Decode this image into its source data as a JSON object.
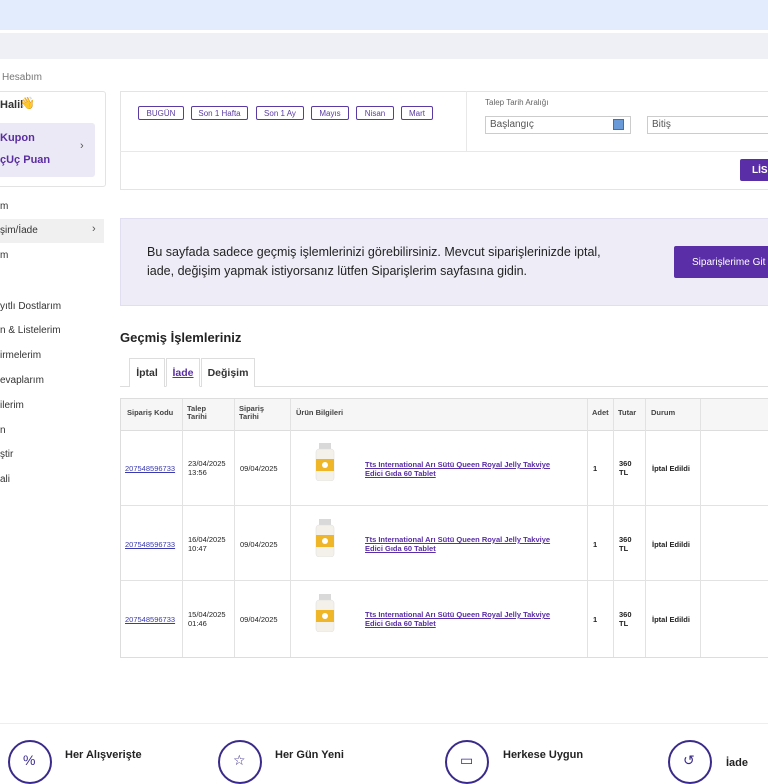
{
  "breadcrumb": "Hesabım",
  "sidebar": {
    "greeting": "Halil",
    "wave_icon": "waving-hand-icon",
    "coupon_line1": "Kupon",
    "coupon_line2": "çUç Puan",
    "items": [
      "m",
      "şim/İade",
      "m",
      "yıtlı Dostlarım",
      "n & Listelerim",
      "irmelerim",
      "evaplarım",
      "ilerim",
      "n",
      "ştir",
      "ali"
    ]
  },
  "filters": {
    "buttons": [
      "BUGÜN",
      "Son 1 Hafta",
      "Son 1 Ay",
      "Mayıs",
      "Nisan",
      "Mart"
    ],
    "range_label": "Talep Tarih Aralığı",
    "start_placeholder": "Başlangıç",
    "end_placeholder": "Bitiş",
    "list_button": "LİS"
  },
  "banner": {
    "text": "Bu sayfada sadece geçmiş işlemlerinizi görebilirsiniz. Mevcut siparişlerinizde iptal, iade, değişim yapmak istiyorsanız lütfen Siparişlerim sayfasına gidin.",
    "button": "Siparişlerime Git"
  },
  "section_title": "Geçmiş İşlemleriniz",
  "tabs": [
    {
      "label": "İptal",
      "active": false
    },
    {
      "label": "İade",
      "active": true
    },
    {
      "label": "Değişim",
      "active": false
    }
  ],
  "table": {
    "headers": {
      "order_code": "Sipariş Kodu",
      "request_date": "Talep Tarihi",
      "order_date": "Sipariş Tarihi",
      "product": "Ürün Bilgileri",
      "qty": "Adet",
      "total": "Tutar",
      "status": "Durum"
    },
    "rows": [
      {
        "order_code": "207548596733",
        "request_date": "23/04/2025",
        "request_time": "13:56",
        "order_date": "09/04/2025",
        "product": "Tts International Arı Sütü Queen Royal Jelly Takviye Edici Gıda 60 Tablet",
        "qty": "1",
        "total": "360",
        "currency": "TL",
        "status": "İptal Edildi"
      },
      {
        "order_code": "207548596733",
        "request_date": "16/04/2025",
        "request_time": "10:47",
        "order_date": "09/04/2025",
        "product": "Tts International Arı Sütü Queen Royal Jelly Takviye Edici Gıda 60 Tablet",
        "qty": "1",
        "total": "360",
        "currency": "TL",
        "status": "İptal Edildi"
      },
      {
        "order_code": "207548596733",
        "request_date": "15/04/2025",
        "request_time": "01:46",
        "order_date": "09/04/2025",
        "product": "Tts International Arı Sütü Queen Royal Jelly Takviye Edici Gıda 60 Tablet",
        "qty": "1",
        "total": "360",
        "currency": "TL",
        "status": "İptal Edildi"
      }
    ]
  },
  "footer": [
    {
      "label": "Her Alışverişte",
      "icon": "percent-tag-icon"
    },
    {
      "label": "Her Gün Yeni",
      "icon": "star-icon"
    },
    {
      "label": "Herkese Uygun",
      "icon": "card-icon"
    },
    {
      "label": "İade",
      "icon": "return-icon"
    }
  ],
  "colors": {
    "accent": "#5a2ea6",
    "banner_bg": "#eeedf7",
    "top_bar": "#e3ecfd"
  }
}
